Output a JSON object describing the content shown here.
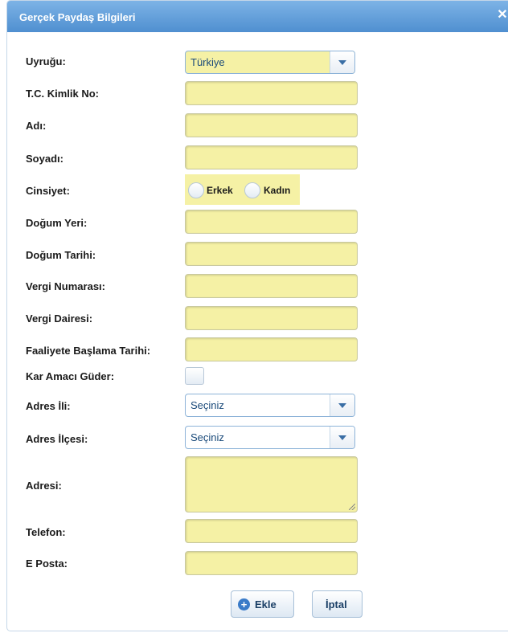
{
  "dialog": {
    "title": "Gerçek Paydaş Bilgileri",
    "close_icon": "close-icon"
  },
  "fields": {
    "uyrugu": {
      "label": "Uyruğu:",
      "value": "Türkiye"
    },
    "tc_kimlik_no": {
      "label": "T.C. Kimlik No:",
      "value": ""
    },
    "adi": {
      "label": "Adı:",
      "value": ""
    },
    "soyadi": {
      "label": "Soyadı:",
      "value": ""
    },
    "cinsiyet": {
      "label": "Cinsiyet:",
      "options": [
        "Erkek",
        "Kadın"
      ]
    },
    "dogum_yeri": {
      "label": "Doğum Yeri:",
      "value": ""
    },
    "dogum_tarihi": {
      "label": "Doğum Tarihi:",
      "value": ""
    },
    "vergi_numarasi": {
      "label": "Vergi Numarası:",
      "value": ""
    },
    "vergi_dairesi": {
      "label": "Vergi Dairesi:",
      "value": ""
    },
    "faaliyete_baslama_tarihi": {
      "label": "Faaliyete Başlama Tarihi:",
      "value": ""
    },
    "kar_amaci_guder": {
      "label": "Kar Amacı Güder:",
      "checked": false
    },
    "adres_ili": {
      "label": "Adres İli:",
      "value": "Seçiniz"
    },
    "adres_ilcesi": {
      "label": "Adres İlçesi:",
      "value": "Seçiniz"
    },
    "adresi": {
      "label": "Adresi:",
      "value": ""
    },
    "telefon": {
      "label": "Telefon:",
      "value": ""
    },
    "e_posta": {
      "label": "E Posta:",
      "value": ""
    }
  },
  "buttons": {
    "ekle": "Ekle",
    "iptal": "İptal"
  },
  "colors": {
    "title_bar": "#5b9bd8",
    "input_fill": "#f5f1a5",
    "select_border": "#8db3d8"
  }
}
